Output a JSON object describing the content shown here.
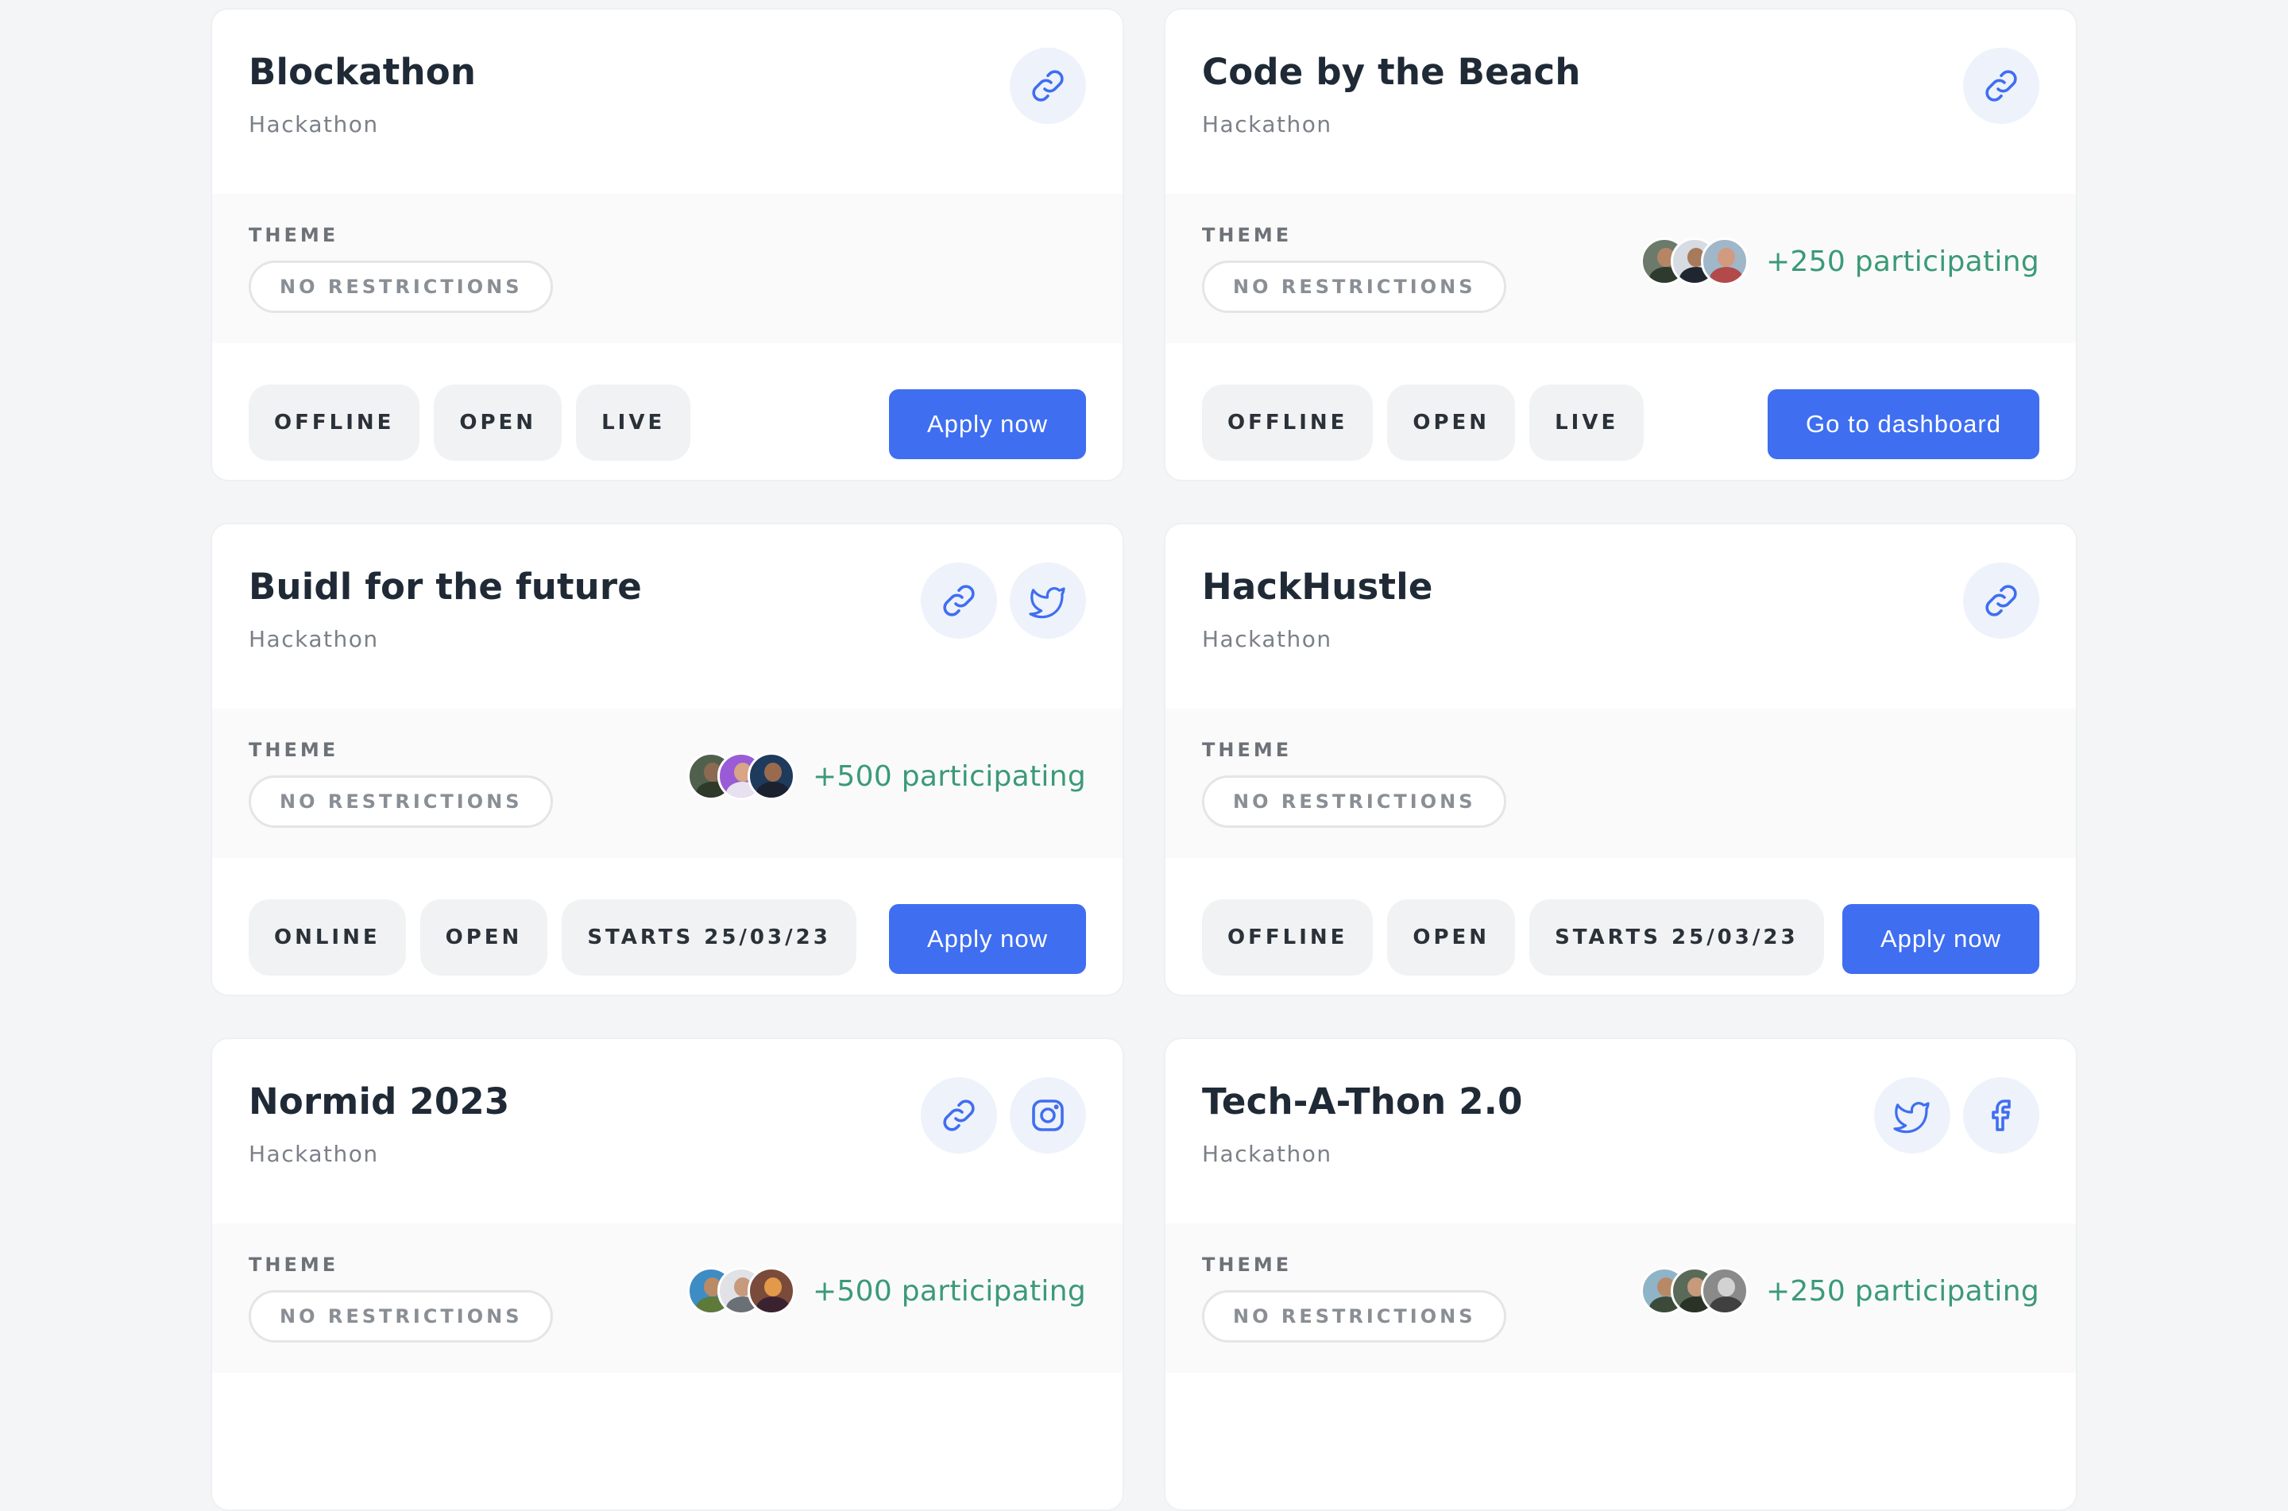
{
  "colors": {
    "accent": "#3f6ef0",
    "participating": "#3b9a78",
    "icon_tint": "#3f6ef0"
  },
  "cards": [
    {
      "title": "Blockathon",
      "subtitle": "Hackathon",
      "icons": [
        "link-icon"
      ],
      "theme_label": "THEME",
      "theme": "NO RESTRICTIONS",
      "participants": null,
      "tags": [
        "OFFLINE",
        "OPEN",
        "LIVE"
      ],
      "cta": "Apply now"
    },
    {
      "title": "Code by the Beach",
      "subtitle": "Hackathon",
      "icons": [
        "link-icon"
      ],
      "theme_label": "THEME",
      "theme": "NO RESTRICTIONS",
      "participants": "+250 participating",
      "tags": [
        "OFFLINE",
        "OPEN",
        "LIVE"
      ],
      "cta": "Go to dashboard"
    },
    {
      "title": "Buidl for the future",
      "subtitle": "Hackathon",
      "icons": [
        "link-icon",
        "twitter-icon"
      ],
      "theme_label": "THEME",
      "theme": "NO RESTRICTIONS",
      "participants": "+500 participating",
      "tags": [
        "ONLINE",
        "OPEN",
        "STARTS 25/03/23"
      ],
      "cta": "Apply now"
    },
    {
      "title": "HackHustle",
      "subtitle": "Hackathon",
      "icons": [
        "link-icon"
      ],
      "theme_label": "THEME",
      "theme": "NO RESTRICTIONS",
      "participants": null,
      "tags": [
        "OFFLINE",
        "OPEN",
        "STARTS 25/03/23"
      ],
      "cta": "Apply now"
    },
    {
      "title": "Normid 2023",
      "subtitle": "Hackathon",
      "icons": [
        "link-icon",
        "instagram-icon"
      ],
      "theme_label": "THEME",
      "theme": "NO RESTRICTIONS",
      "participants": "+500 participating",
      "tags": [],
      "cta": null
    },
    {
      "title": "Tech-A-Thon 2.0",
      "subtitle": "Hackathon",
      "icons": [
        "twitter-icon",
        "facebook-icon"
      ],
      "theme_label": "THEME",
      "theme": "NO RESTRICTIONS",
      "participants": "+250 participating",
      "tags": [],
      "cta": null
    }
  ]
}
